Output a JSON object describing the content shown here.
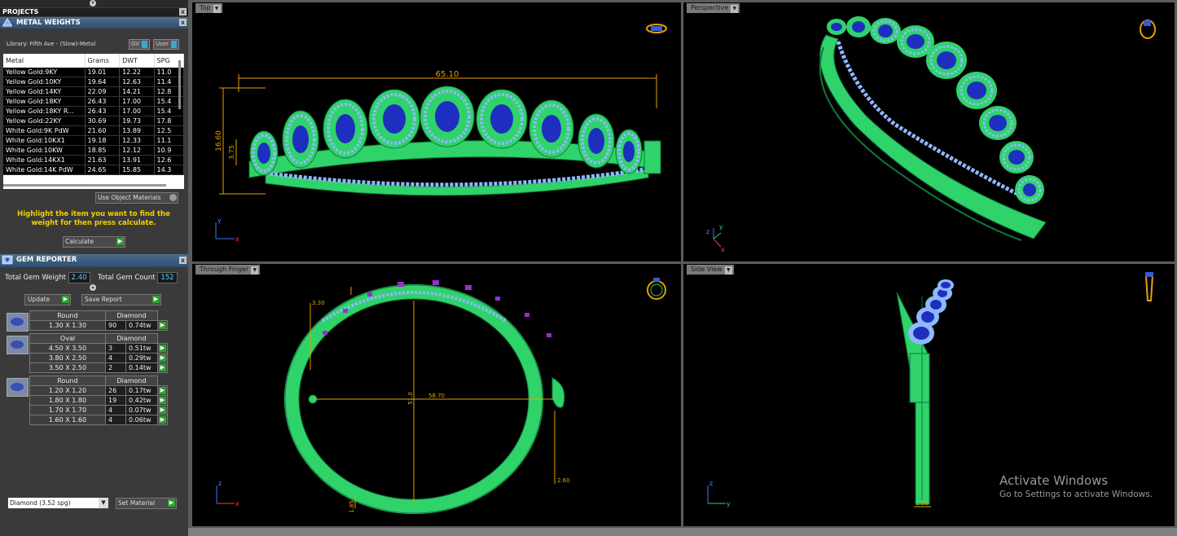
{
  "projects": {
    "title": "PROJECTS",
    "close": "x"
  },
  "metal_weights": {
    "title": "METAL WEIGHTS",
    "library": "Library: Fifth Ave - (Slow)-Metal",
    "toggle1": "GV",
    "toggle2": "User",
    "columns": [
      "Metal",
      "Grams",
      "DWT",
      "SPG"
    ],
    "rows": [
      [
        "Yellow Gold:9KY",
        "19.01",
        "12.22",
        "11.0"
      ],
      [
        "Yellow Gold:10KY",
        "19.64",
        "12.63",
        "11.4"
      ],
      [
        "Yellow Gold:14KY",
        "22.09",
        "14.21",
        "12.8"
      ],
      [
        "Yellow Gold:18KY",
        "26.43",
        "17.00",
        "15.4"
      ],
      [
        "Yellow Gold:18KY R...",
        "26.43",
        "17.00",
        "15.4"
      ],
      [
        "Yellow Gold:22KY",
        "30.69",
        "19.73",
        "17.8"
      ],
      [
        "White Gold:9K PdW",
        "21.60",
        "13.89",
        "12.5"
      ],
      [
        "White Gold:10KX1",
        "19.18",
        "12.33",
        "11.1"
      ],
      [
        "White Gold:10KW",
        "18.85",
        "12.12",
        "10.9"
      ],
      [
        "White Gold:14KX1",
        "21.63",
        "13.91",
        "12.6"
      ],
      [
        "White Gold:14K PdW",
        "24.65",
        "15.85",
        "14.3"
      ]
    ],
    "use_object_materials": "Use Object Materials",
    "hint": "Highlight the item you want to find the weight for then press calculate.",
    "calculate": "Calculate"
  },
  "gem_reporter": {
    "title": "GEM REPORTER",
    "total_weight_label": "Total Gem Weight",
    "total_weight": "2.40",
    "total_count_label": "Total Gem Count",
    "total_count": "152",
    "update": "Update",
    "save_report": "Save Report",
    "groups": [
      {
        "shape": "Round",
        "material": "Diamond",
        "rows": [
          [
            "1.30 X 1.30",
            "90",
            "0.74tw"
          ]
        ]
      },
      {
        "shape": "Oval",
        "material": "Diamond",
        "rows": [
          [
            "4.50 X 3.50",
            "3",
            "0.51tw"
          ],
          [
            "3.80 X 2.50",
            "4",
            "0.29tw"
          ],
          [
            "3.50 X 2.50",
            "2",
            "0.14tw"
          ]
        ]
      },
      {
        "shape": "Round",
        "material": "Diamond",
        "rows": [
          [
            "1.20 X 1.20",
            "26",
            "0.17tw"
          ],
          [
            "1.80 X 1.80",
            "19",
            "0.42tw"
          ],
          [
            "1.70 X 1.70",
            "4",
            "0.07tw"
          ],
          [
            "1.60 X 1.60",
            "4",
            "0.06tw"
          ]
        ]
      }
    ],
    "material_select": "Diamond   (3.52 spg)",
    "set_material": "Set Material"
  },
  "viewports": {
    "top": {
      "label": "Top",
      "dim_width": "65.10",
      "dim_height": "16.60",
      "dim_small": "3.75"
    },
    "perspective": {
      "label": "Perspective"
    },
    "through_finger": {
      "label": "Through Finger",
      "dim_diameter": "58.70",
      "dim_vertical": "51.0",
      "dim_top": "3.30",
      "dim_right": "2.60",
      "dim_bottom": "1.85"
    },
    "side": {
      "label": "Side View",
      "dim_bottom": "1.55"
    }
  },
  "watermark": {
    "title": "Activate Windows",
    "subtitle": "Go to Settings to activate Windows."
  },
  "colors": {
    "metal": "#2fd36a",
    "gem_blue": "#1e2fbf",
    "accent_diamond": "#8fb8ff",
    "prong": "#9a2bd0",
    "dimension": "#e6a000"
  }
}
